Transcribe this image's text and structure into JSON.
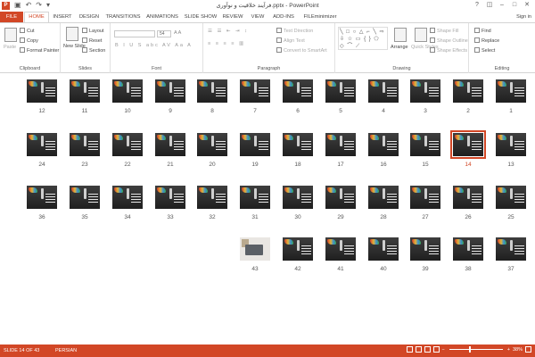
{
  "title": "فرآیند خلاقیت و نوآوری.pptx - PowerPoint",
  "qat": {
    "save_icon": "save-icon",
    "undo_icon": "undo-icon",
    "redo_icon": "redo-icon",
    "customize_icon": "customize-icon"
  },
  "window": {
    "help": "?",
    "restore": "◫",
    "minimize": "–",
    "maximize": "□",
    "close": "✕"
  },
  "tabs": [
    "FILE",
    "HOME",
    "INSERT",
    "DESIGN",
    "TRANSITIONS",
    "ANIMATIONS",
    "SLIDE SHOW",
    "REVIEW",
    "VIEW",
    "ADD-INS",
    "FILEminimizer"
  ],
  "signin": "Sign in",
  "ribbon": {
    "clipboard": {
      "label": "Clipboard",
      "paste": "Paste",
      "cut": "Cut",
      "copy": "Copy",
      "format_painter": "Format Painter"
    },
    "slides": {
      "label": "Slides",
      "new_slide": "New Slide",
      "layout": "Layout",
      "reset": "Reset",
      "section": "Section"
    },
    "font": {
      "label": "Font",
      "font_name": "",
      "font_size": "54"
    },
    "paragraph": {
      "label": "Paragraph",
      "text_direction": "Text Direction",
      "align_text": "Align Text",
      "convert_smartart": "Convert to SmartArt"
    },
    "drawing": {
      "label": "Drawing",
      "arrange": "Arrange",
      "quick_styles": "Quick Styles",
      "shape_fill": "Shape Fill",
      "shape_outline": "Shape Outline",
      "shape_effects": "Shape Effects"
    },
    "editing": {
      "label": "Editing",
      "find": "Find",
      "replace": "Replace",
      "select": "Select"
    }
  },
  "slides": [
    {
      "n": "1"
    },
    {
      "n": "2"
    },
    {
      "n": "3"
    },
    {
      "n": "4"
    },
    {
      "n": "5"
    },
    {
      "n": "6"
    },
    {
      "n": "7"
    },
    {
      "n": "8"
    },
    {
      "n": "9"
    },
    {
      "n": "10"
    },
    {
      "n": "11"
    },
    {
      "n": "12"
    },
    {
      "n": "13"
    },
    {
      "n": "14",
      "selected": true
    },
    {
      "n": "15"
    },
    {
      "n": "16"
    },
    {
      "n": "17"
    },
    {
      "n": "18"
    },
    {
      "n": "19"
    },
    {
      "n": "20"
    },
    {
      "n": "21"
    },
    {
      "n": "22"
    },
    {
      "n": "23"
    },
    {
      "n": "24"
    },
    {
      "n": "25"
    },
    {
      "n": "26"
    },
    {
      "n": "27"
    },
    {
      "n": "28"
    },
    {
      "n": "29"
    },
    {
      "n": "30"
    },
    {
      "n": "31"
    },
    {
      "n": "32"
    },
    {
      "n": "33"
    },
    {
      "n": "34"
    },
    {
      "n": "35"
    },
    {
      "n": "36"
    },
    {
      "n": "37"
    },
    {
      "n": "38"
    },
    {
      "n": "39"
    },
    {
      "n": "40"
    },
    {
      "n": "41"
    },
    {
      "n": "42"
    },
    {
      "n": "43",
      "photo": true
    }
  ],
  "status": {
    "slide_info": "SLIDE 14 OF 43",
    "language": "PERSIAN",
    "zoom": "38%",
    "zoom_fraction": 0.38
  },
  "colors": {
    "accent": "#d24726"
  }
}
